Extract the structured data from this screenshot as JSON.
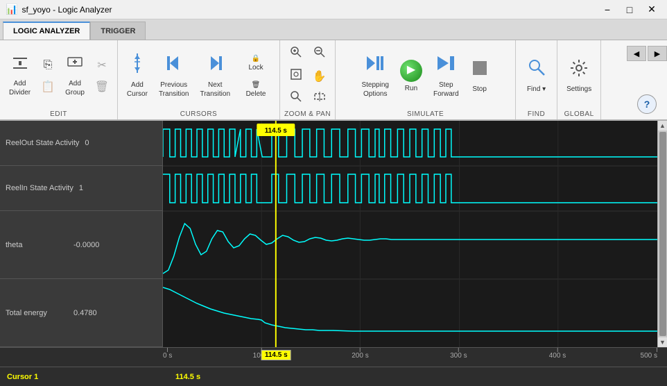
{
  "titlebar": {
    "title": "sf_yoyo - Logic Analyzer",
    "icon": "📊"
  },
  "tabs": [
    {
      "id": "logic-analyzer",
      "label": "LOGIC ANALYZER",
      "active": true
    },
    {
      "id": "trigger",
      "label": "TRIGGER",
      "active": false
    }
  ],
  "ribbon": {
    "groups": [
      {
        "id": "edit",
        "label": "EDIT",
        "buttons": [
          {
            "id": "add-divider",
            "label": "Add\nDivider",
            "icon": "➕"
          },
          {
            "id": "add-group",
            "label": "Add\nGroup",
            "icon": "➕"
          }
        ],
        "small_buttons": [
          {
            "id": "copy",
            "icon": "📋",
            "enabled": true
          },
          {
            "id": "paste",
            "icon": "📋",
            "enabled": false
          },
          {
            "id": "cut",
            "icon": "✂",
            "enabled": false
          },
          {
            "id": "delete-small",
            "icon": "🗑",
            "enabled": false
          }
        ]
      },
      {
        "id": "cursors",
        "label": "CURSORS",
        "buttons": [
          {
            "id": "add-cursor",
            "label": "Add\nCursor",
            "icon": "↕"
          },
          {
            "id": "prev-transition",
            "label": "Previous\nTransition",
            "icon": "◀"
          },
          {
            "id": "next-transition",
            "label": "Next\nTransition",
            "icon": "▶"
          },
          {
            "id": "lock",
            "label": "Lock",
            "icon": "🔒"
          },
          {
            "id": "delete",
            "label": "Delete",
            "icon": "🗑"
          }
        ]
      },
      {
        "id": "zoom-pan",
        "label": "ZOOM & PAN",
        "buttons": [
          {
            "id": "zoom-in",
            "icon": "🔍+",
            "small": true
          },
          {
            "id": "zoom-out",
            "icon": "🔍-",
            "small": true
          },
          {
            "id": "zoom-fit",
            "icon": "⊞",
            "small": true
          },
          {
            "id": "pan",
            "icon": "✋",
            "small": true
          },
          {
            "id": "zoom-out2",
            "icon": "🔍",
            "small": true
          },
          {
            "id": "zoom-sel",
            "icon": "⊟",
            "small": true
          }
        ]
      },
      {
        "id": "simulate",
        "label": "SIMULATE",
        "buttons": [
          {
            "id": "stepping-options",
            "label": "Stepping\nOptions",
            "icon": "⏭"
          },
          {
            "id": "run",
            "label": "Run",
            "icon": "▶",
            "special": "run"
          },
          {
            "id": "step-forward",
            "label": "Step\nForward",
            "icon": "⏭"
          },
          {
            "id": "stop",
            "label": "Stop",
            "icon": "⏹"
          }
        ]
      },
      {
        "id": "find",
        "label": "FIND",
        "buttons": [
          {
            "id": "find",
            "label": "Find",
            "icon": "🔍"
          }
        ]
      },
      {
        "id": "global",
        "label": "GLOBAL",
        "buttons": [
          {
            "id": "settings",
            "label": "Settings",
            "icon": "⚙"
          }
        ]
      }
    ],
    "help_button": "?"
  },
  "signals": [
    {
      "id": "reelout-state",
      "name": "ReelOut State Activity",
      "value": "0"
    },
    {
      "id": "reelin-state",
      "name": "ReelIn State Activity",
      "value": "1"
    },
    {
      "id": "theta",
      "name": "theta",
      "value": "-0.0000"
    },
    {
      "id": "total-energy",
      "name": "Total energy",
      "value": "0.4780"
    }
  ],
  "signal_row_heights": [
    60,
    60,
    80,
    80
  ],
  "time_axis": {
    "ticks": [
      "0 s",
      "100 s",
      "200 s",
      "300 s",
      "400 s",
      "500 s"
    ],
    "cursor1_label": "Cursor 1",
    "cursor1_time": "114.5 s",
    "cursor1_box_time": "114.5 s",
    "cursor_position_pct": 0.229
  },
  "colors": {
    "waveform_cyan": "#00ffff",
    "cursor_yellow": "#ffff00",
    "background_dark": "#1a1a1a",
    "panel_bg": "#3c3c3c",
    "grid_line": "#333333"
  }
}
